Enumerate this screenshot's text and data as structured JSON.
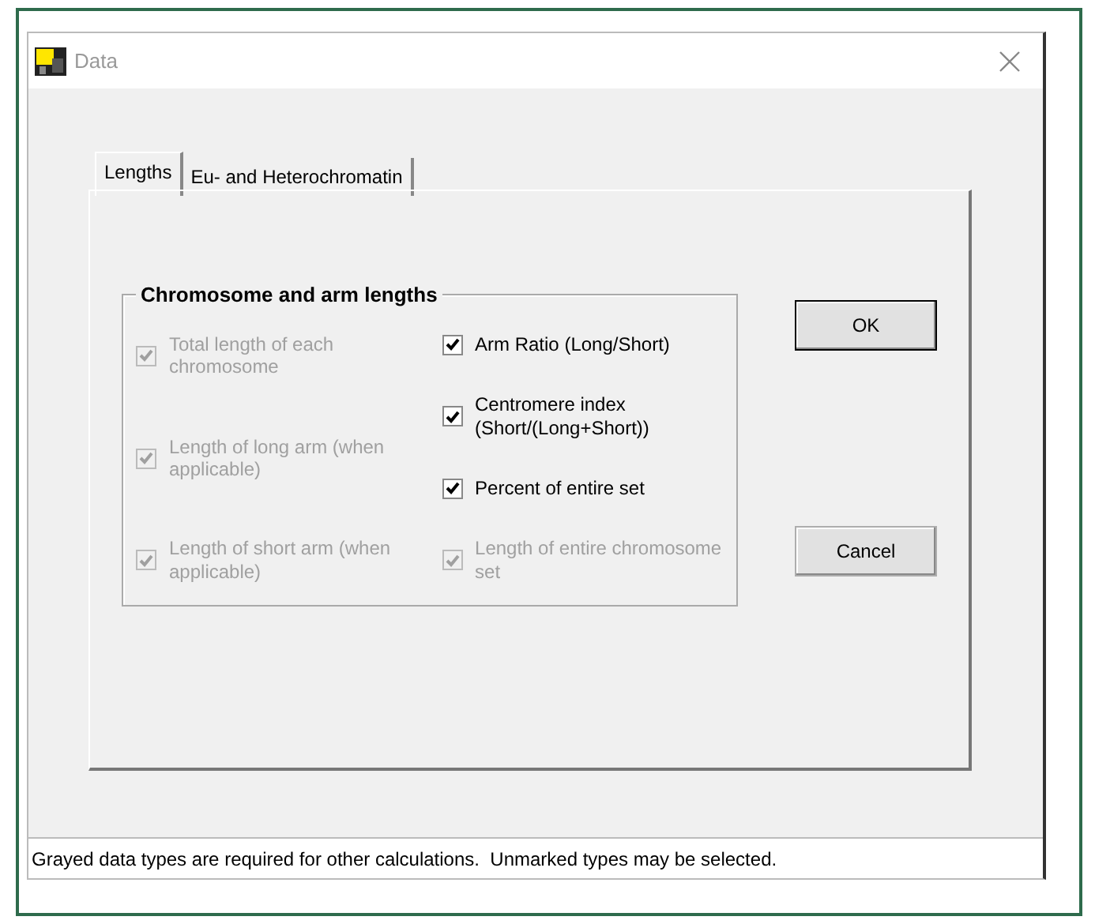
{
  "window": {
    "title": "Data"
  },
  "tabs": [
    {
      "label": "Lengths",
      "selected": true
    },
    {
      "label": "Eu- and Heterochromatin",
      "selected": false
    }
  ],
  "group": {
    "title": "Chromosome and arm lengths",
    "columns": [
      [
        {
          "label": "Total length of each chromosome",
          "checked": true,
          "disabled": true
        },
        {
          "label": "Length of long arm (when applicable)",
          "checked": true,
          "disabled": true
        },
        {
          "label": "Length of short arm (when applicable)",
          "checked": true,
          "disabled": true
        }
      ],
      [
        {
          "label": "Arm Ratio (Long/Short)",
          "checked": true,
          "disabled": false
        },
        {
          "label": "Centromere index (Short/(Long+Short))",
          "checked": true,
          "disabled": false
        },
        {
          "label": "Percent of entire set",
          "checked": true,
          "disabled": false
        },
        {
          "label": "Length of entire chromosome set",
          "checked": true,
          "disabled": true
        }
      ]
    ]
  },
  "buttons": [
    {
      "label": "OK",
      "default": true
    },
    {
      "label": "Cancel",
      "default": false
    }
  ],
  "status_bar": "Grayed data types are required for other calculations.  Unmarked types may be selected."
}
